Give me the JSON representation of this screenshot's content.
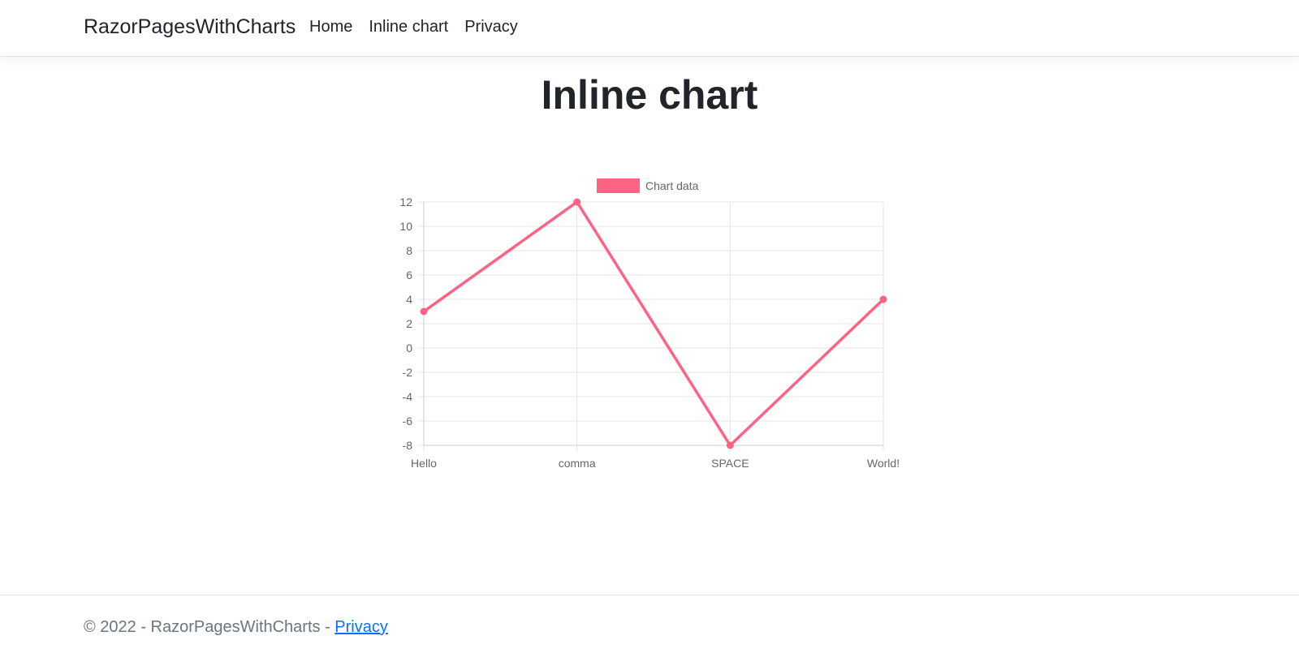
{
  "navbar": {
    "brand": "RazorPagesWithCharts",
    "links": [
      "Home",
      "Inline chart",
      "Privacy"
    ]
  },
  "page": {
    "title": "Inline chart"
  },
  "chart_data": {
    "type": "line",
    "categories": [
      "Hello",
      "comma",
      "SPACE",
      "World!"
    ],
    "series": [
      {
        "name": "Chart data",
        "values": [
          3,
          12,
          -8,
          4
        ],
        "color": "#ff6384"
      }
    ],
    "ylim": [
      -8,
      12
    ],
    "yticks": [
      "12",
      "10",
      "8",
      "6",
      "4",
      "2",
      "0",
      "-2",
      "-4",
      "-6",
      "-8"
    ],
    "grid": true,
    "legend_position": "top"
  },
  "footer": {
    "text": "© 2022 - RazorPagesWithCharts - ",
    "link": "Privacy"
  },
  "colors": {
    "series": "#ff6384",
    "grid": "#e5e5e5",
    "axis_text": "#666666",
    "link": "#0d6efd"
  }
}
